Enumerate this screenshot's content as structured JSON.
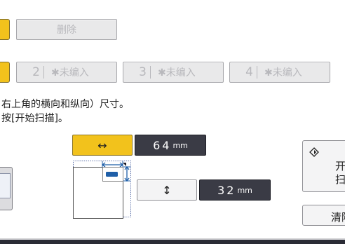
{
  "toolbar": {
    "delete_label": "删除"
  },
  "destinations": [
    {
      "number": "2",
      "label": "✱未编入"
    },
    {
      "number": "3",
      "label": "✱未编入"
    },
    {
      "number": "4",
      "label": "✱未编入"
    }
  ],
  "instructions": {
    "line1": "右上角的横向和纵向）尺寸。",
    "line2": "按[开始扫描]。"
  },
  "horizontal": {
    "icon": "↔",
    "value": "64",
    "unit": "mm",
    "active": true
  },
  "vertical": {
    "icon": "↕",
    "value": "32",
    "unit": "mm",
    "active": false
  },
  "side_buttons": {
    "start_icon": "start-diamond-icon",
    "start_line1": "开",
    "start_line2": "扫",
    "clear_label": "清除"
  },
  "colors": {
    "accent_yellow": "#f2c21c",
    "value_bg": "#3a3b45",
    "disabled_bg": "#e9e9ea",
    "diagram_blue": "#1f5fa8"
  }
}
